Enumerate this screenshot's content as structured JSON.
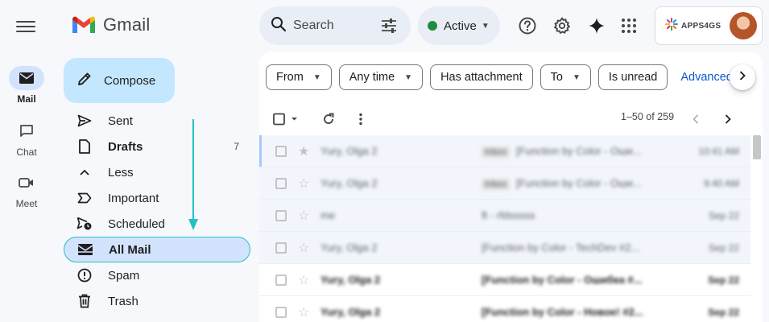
{
  "app": {
    "name": "Gmail"
  },
  "rail": [
    {
      "label": "Mail",
      "icon": "mail-icon",
      "active": true
    },
    {
      "label": "Chat",
      "icon": "chat-icon",
      "active": false
    },
    {
      "label": "Meet",
      "icon": "video-icon",
      "active": false
    }
  ],
  "search": {
    "placeholder": "Search"
  },
  "status": {
    "label": "Active",
    "color": "#1e8e3e"
  },
  "account": {
    "brand": "APPS4GS"
  },
  "compose": {
    "label": "Compose"
  },
  "nav": {
    "sent": "Sent",
    "drafts": "Drafts",
    "drafts_count": "7",
    "less": "Less",
    "important": "Important",
    "scheduled": "Scheduled",
    "all_mail": "All Mail",
    "spam": "Spam",
    "trash": "Trash"
  },
  "filters": {
    "from": "From",
    "any_time": "Any time",
    "has_attachment": "Has attachment",
    "to": "To",
    "is_unread": "Is unread",
    "advanced": "Advanced se"
  },
  "toolbar": {
    "pagination": "1–50 of 259"
  },
  "emails": [
    {
      "from": "Yury, Olga 2",
      "tag": "Inbox",
      "subject": "[Function by Color - Оши...",
      "date": "10:41 AM",
      "unread": false
    },
    {
      "from": "Yury, Olga 2",
      "tag": "Inbox",
      "subject": "[Function by Color - Оши...",
      "date": "9:40 AM",
      "unread": false
    },
    {
      "from": "me",
      "tag": "",
      "subject": "ft - rfdsssss",
      "date": "Sep 22",
      "unread": false
    },
    {
      "from": "Yury, Olga 2",
      "tag": "",
      "subject": "[Function by Color - TechDev #2...",
      "date": "Sep 22",
      "unread": false
    },
    {
      "from": "Yury, Olga 2",
      "tag": "",
      "subject": "[Function by Color - Ошибка #...",
      "date": "Sep 22",
      "unread": true
    },
    {
      "from": "Yury, Olga 2",
      "tag": "",
      "subject": "[Function by Color - Новое! #2...",
      "date": "Sep 22",
      "unread": true
    }
  ],
  "colors": {
    "accent": "#0b57d0",
    "compose_bg": "#c2e7ff",
    "selected_bg": "#d3e3fd",
    "highlight_outline": "#22c2c2"
  }
}
